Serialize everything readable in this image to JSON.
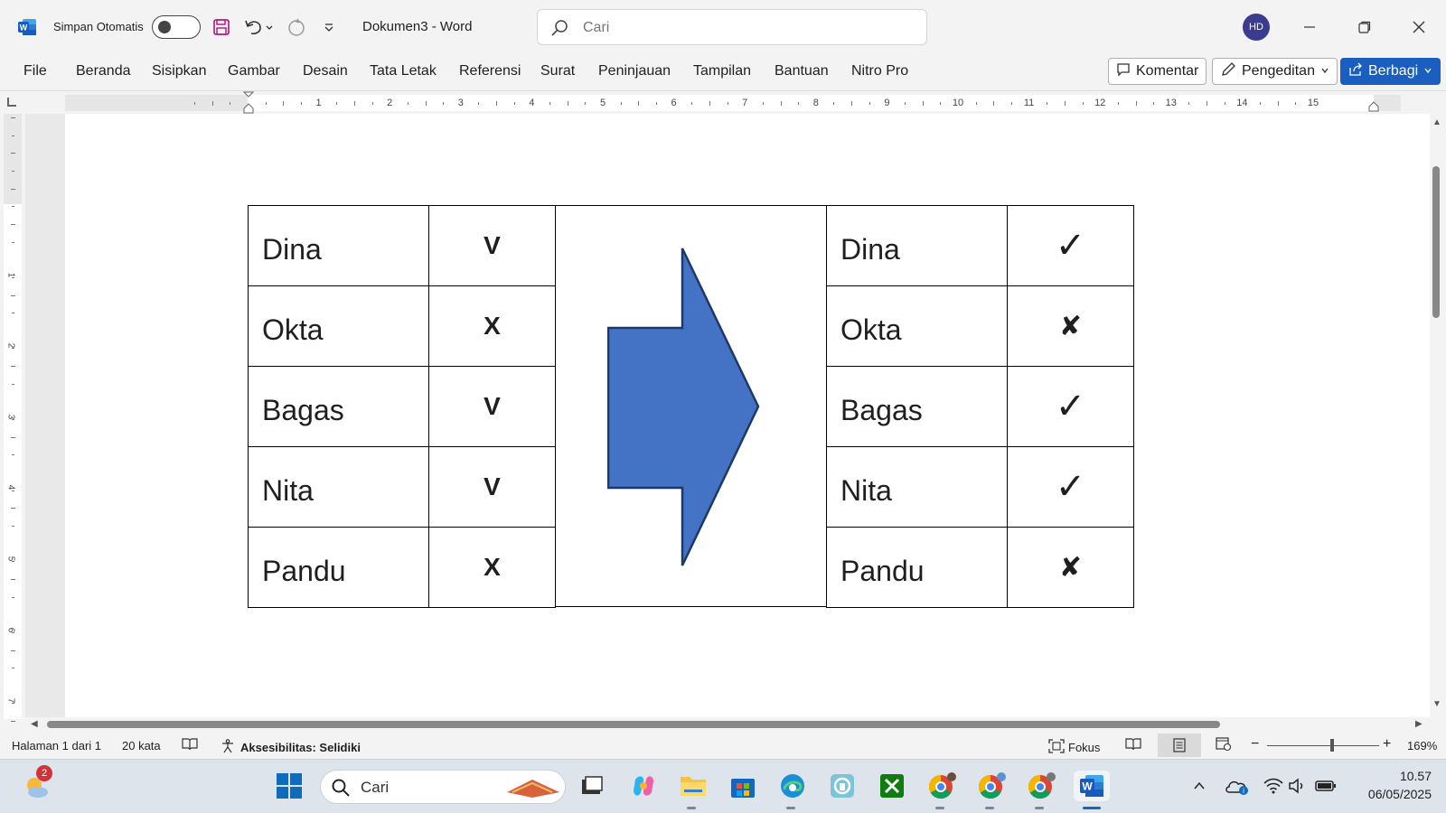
{
  "titlebar": {
    "autosave_label": "Simpan Otomatis",
    "doc_name": "Dokumen3  -  Word",
    "search_placeholder": "Cari",
    "user_initials": "HD"
  },
  "ribbon": {
    "tabs": [
      "File",
      "Beranda",
      "Sisipkan",
      "Gambar",
      "Desain",
      "Tata Letak",
      "Referensi",
      "Surat",
      "Peninjauan",
      "Tampilan",
      "Bantuan",
      "Nitro Pro"
    ],
    "comment_label": "Komentar",
    "editing_label": "Pengeditan",
    "share_label": "Berbagi"
  },
  "ruler": {
    "h_numbers": [
      "1",
      "2",
      "3",
      "4",
      "5",
      "6",
      "7",
      "8",
      "9",
      "10",
      "11",
      "12",
      "13",
      "14",
      "15"
    ],
    "v_numbers": [
      "1",
      "2",
      "3",
      "4",
      "5",
      "6",
      "7"
    ]
  },
  "document": {
    "left_table": [
      {
        "name": "Dina",
        "mark": "V"
      },
      {
        "name": "Okta",
        "mark": "X"
      },
      {
        "name": "Bagas",
        "mark": "V"
      },
      {
        "name": "Nita",
        "mark": "V"
      },
      {
        "name": "Pandu",
        "mark": "X"
      }
    ],
    "right_table": [
      {
        "name": "Dina",
        "mark": "✓"
      },
      {
        "name": "Okta",
        "mark": "✘"
      },
      {
        "name": "Bagas",
        "mark": "✓"
      },
      {
        "name": "Nita",
        "mark": "✓"
      },
      {
        "name": "Pandu",
        "mark": "✘"
      }
    ],
    "arrow_color": "#4472c4",
    "arrow_stroke": "#1f3864"
  },
  "statusbar": {
    "page_info": "Halaman 1 dari 1",
    "word_count": "20 kata",
    "accessibility": "Aksesibilitas: Selidiki",
    "focus_label": "Fokus",
    "zoom_level": "169%"
  },
  "taskbar": {
    "weather_badge": "2",
    "search_label": "Cari",
    "time": "10.57",
    "date": "06/05/2025"
  },
  "colors": {
    "word_blue": "#185abd",
    "share_blue": "#1a5fbf",
    "avatar_bg": "#3b3c8f"
  }
}
